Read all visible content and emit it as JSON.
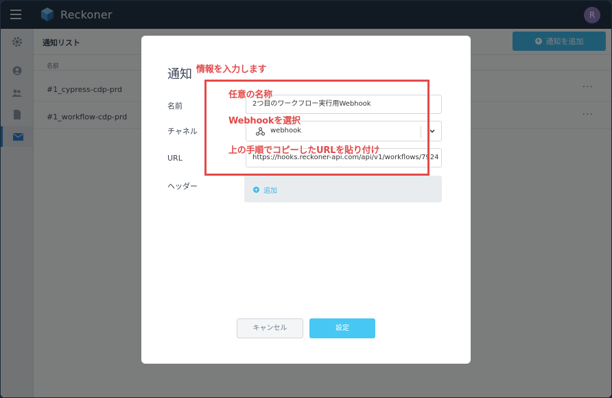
{
  "app": {
    "brand": "Reckoner",
    "user_initial": "R"
  },
  "main": {
    "title": "通知リスト",
    "add_button": "通知を追加",
    "column_header": "名前",
    "rows": [
      {
        "name": "#1_cypress-cdp-prd",
        "more": "···"
      },
      {
        "name": "#1_workflow-cdp-prd",
        "more": "···"
      }
    ]
  },
  "modal": {
    "title": "通知",
    "fields": {
      "name_label": "名前",
      "name_value": "2つ目のワークフロー実行用Webhook",
      "channel_label": "チャネル",
      "channel_value": "webhook",
      "url_label": "URL",
      "url_value": "https://hooks.reckoner-api.com/api/v1/workflows/7924",
      "header_label": "ヘッダー",
      "header_add": "追加"
    },
    "cancel": "キャンセル",
    "ok": "設定"
  },
  "annotations": {
    "info": "情報を入力します",
    "name": "任意の名称",
    "webhook": "Webhookを選択",
    "url": "上の手順でコピーしたURLを貼り付け"
  },
  "colors": {
    "accent": "#47c7f3",
    "annotation": "#e24a4a",
    "topbar": "#233445"
  }
}
